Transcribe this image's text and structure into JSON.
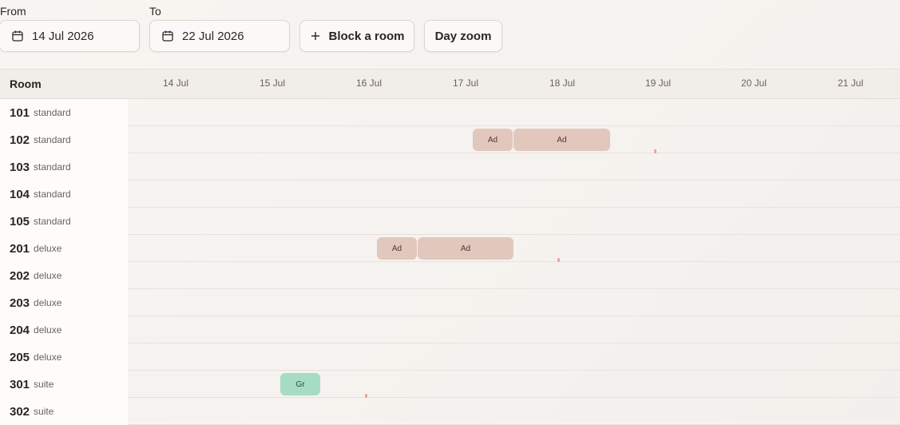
{
  "toolbar": {
    "from_label": "From",
    "from_value": "14 Jul 2026",
    "to_label": "To",
    "to_value": "22 Jul 2026",
    "block_room_label": "Block a room",
    "day_zoom_label": "Day zoom",
    "calendar_icon": "calendar-icon",
    "plus_icon": "plus-icon"
  },
  "grid": {
    "room_header": "Room",
    "days": [
      "14 Jul",
      "15 Jul",
      "16 Jul",
      "17 Jul",
      "18 Jul",
      "19 Jul",
      "20 Jul",
      "21 Jul"
    ],
    "rooms": [
      {
        "number": "101",
        "type": "standard"
      },
      {
        "number": "102",
        "type": "standard"
      },
      {
        "number": "103",
        "type": "standard"
      },
      {
        "number": "104",
        "type": "standard"
      },
      {
        "number": "105",
        "type": "standard"
      },
      {
        "number": "201",
        "type": "deluxe"
      },
      {
        "number": "202",
        "type": "deluxe"
      },
      {
        "number": "203",
        "type": "deluxe"
      },
      {
        "number": "204",
        "type": "deluxe"
      },
      {
        "number": "205",
        "type": "deluxe"
      },
      {
        "number": "301",
        "type": "suite"
      },
      {
        "number": "302",
        "type": "suite"
      }
    ],
    "bookings": [
      {
        "room": "102",
        "label": "Ad",
        "kind": "ad"
      },
      {
        "room": "102",
        "label": "Ad",
        "kind": "ad"
      },
      {
        "room": "201",
        "label": "Ad",
        "kind": "ad"
      },
      {
        "room": "201",
        "label": "Ad",
        "kind": "ad"
      },
      {
        "room": "301",
        "label": "Gr",
        "kind": "gr"
      }
    ]
  },
  "colors": {
    "booking_ad": "#e2c7bd",
    "booking_gr": "#a5dcc2",
    "marker": "#e8a993"
  }
}
